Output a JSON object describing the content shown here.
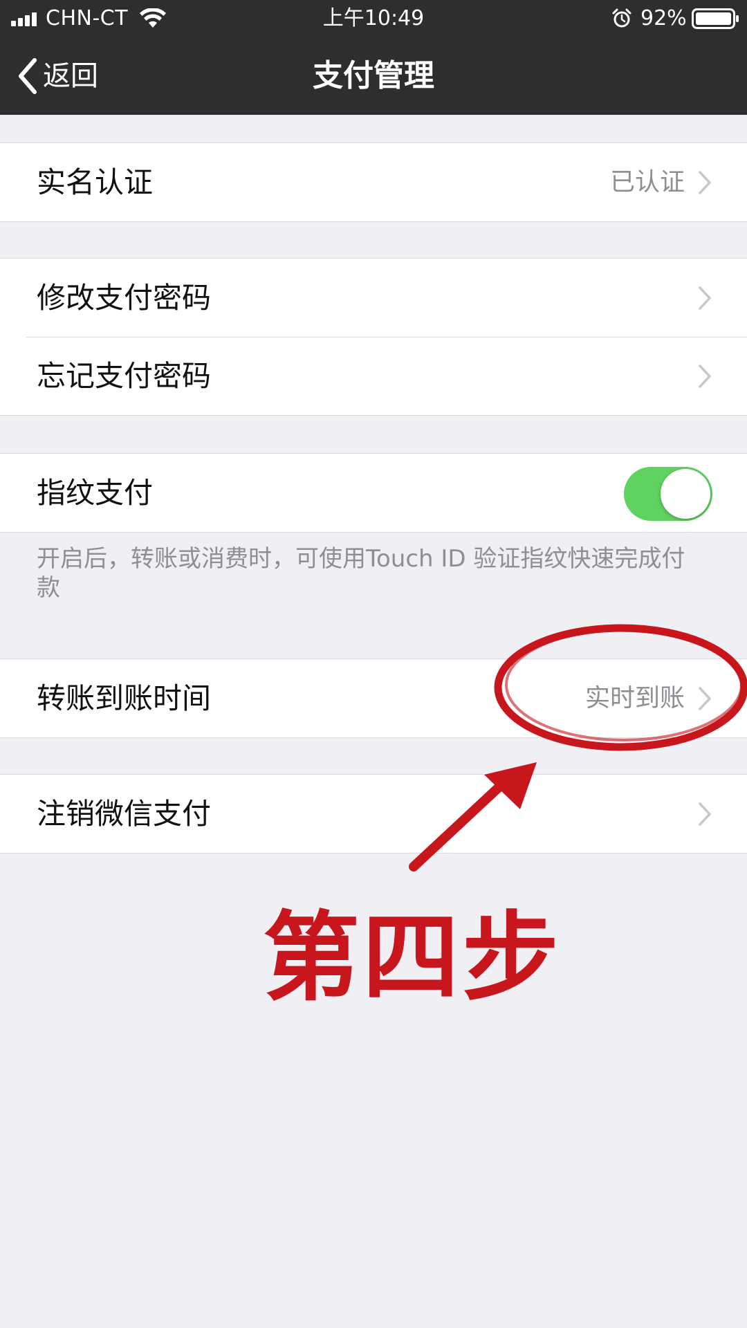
{
  "status_bar": {
    "carrier": "CHN-CT",
    "time": "上午10:49",
    "battery": "92%",
    "icons": [
      "signal-icon",
      "wifi-icon",
      "alarm-icon",
      "battery-icon"
    ]
  },
  "nav": {
    "back_label": "返回",
    "title": "支付管理"
  },
  "groups": [
    {
      "rows": [
        {
          "label": "实名认证",
          "value": "已认证",
          "chevron": true
        }
      ]
    },
    {
      "rows": [
        {
          "label": "修改支付密码",
          "chevron": true
        },
        {
          "label": "忘记支付密码",
          "chevron": true
        }
      ]
    },
    {
      "rows": [
        {
          "label": "指纹支付",
          "toggle_on": true
        }
      ],
      "footnote": "开启后，转账或消费时，可使用Touch ID 验证指纹快速完成付款"
    },
    {
      "rows": [
        {
          "label": "转账到账时间",
          "value": "实时到账",
          "chevron": true
        }
      ]
    },
    {
      "rows": [
        {
          "label": "注销微信支付",
          "chevron": true
        }
      ]
    }
  ],
  "annotation": {
    "step_text": "第四步",
    "color": "#c8161d"
  },
  "colors": {
    "nav_background": "#2e2e31",
    "page_background": "#efeff4",
    "toggle_on": "#5fd25f",
    "secondary_text": "#8e8e93"
  }
}
